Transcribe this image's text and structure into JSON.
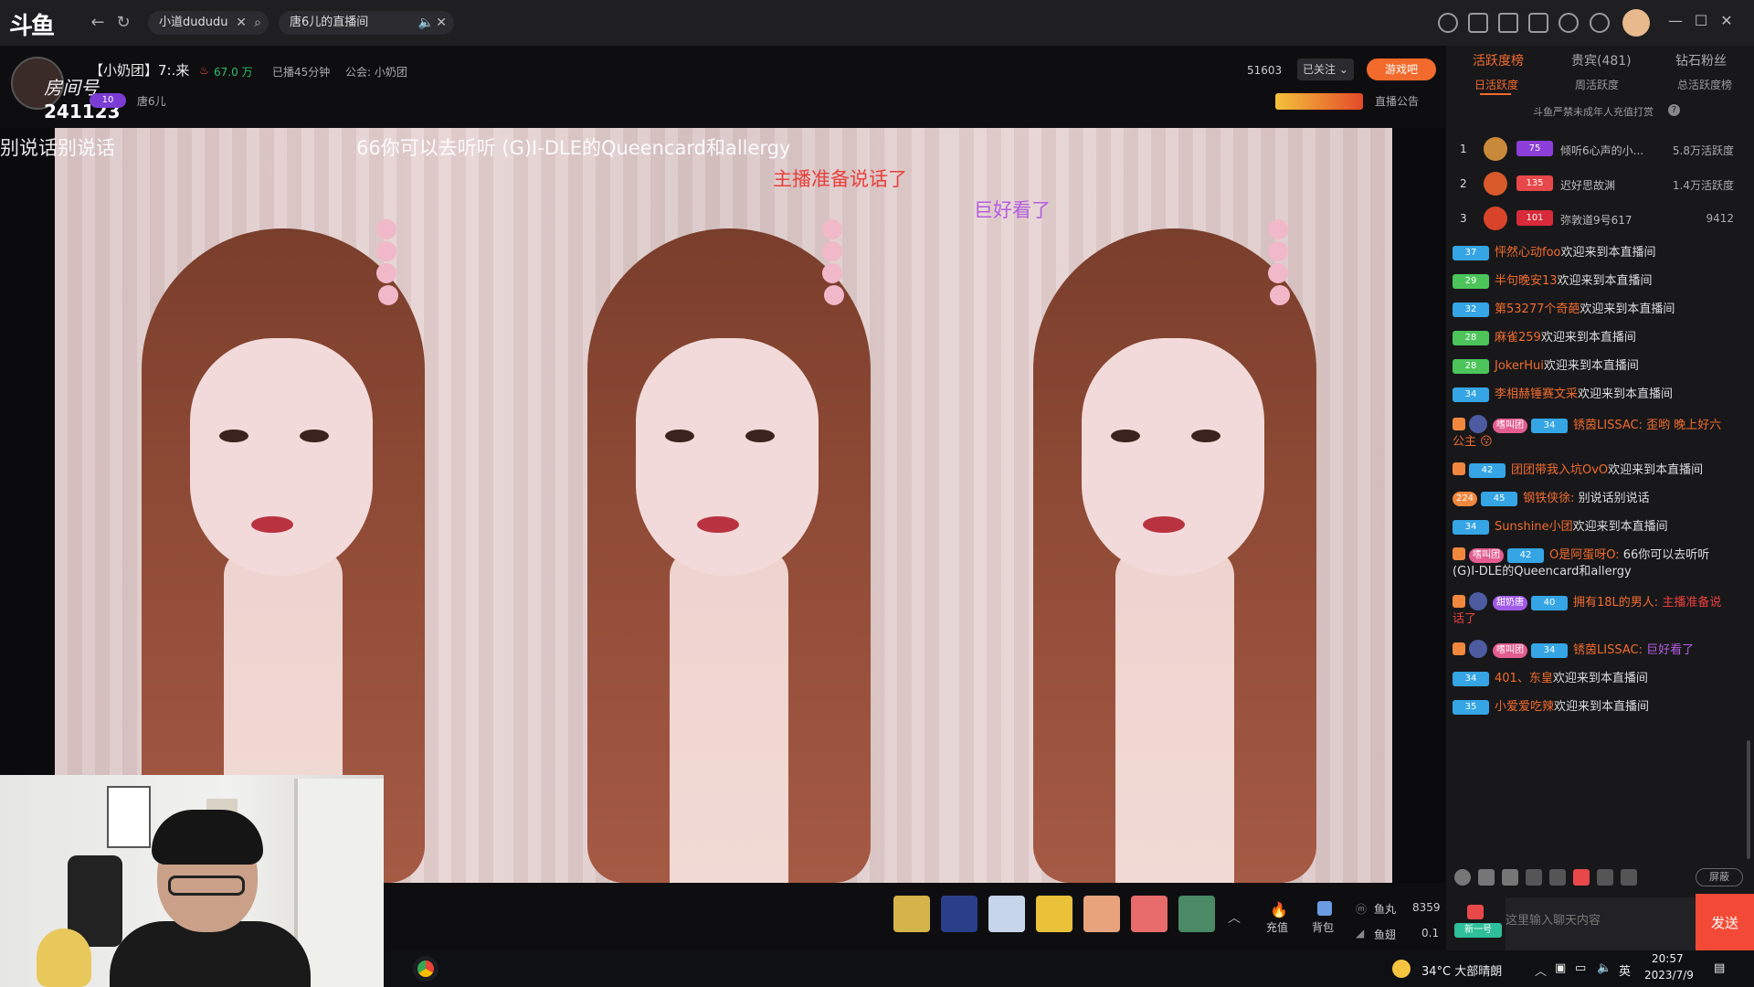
{
  "titlebar": {
    "tabs": [
      {
        "label": "小道dududu"
      },
      {
        "label": "唐6儿的直播间"
      }
    ]
  },
  "room": {
    "title": "【小奶团】7:.来",
    "heat": "67.0 万",
    "duration": "已播45分钟",
    "guild": "公会: 小奶团",
    "room_id": "241123",
    "room_label": "房间号",
    "streamer_name": "唐6儿",
    "follower_count": "51603",
    "follow_status": "已关注",
    "game_btn": "游戏吧",
    "announcement": "直播公告",
    "badge_level": "10"
  },
  "danmu": [
    {
      "text": "别说话别说话",
      "color": "#ffffff"
    },
    {
      "text": "66你可以去听听 (G)I-DLE的Queencard和allergy",
      "color": "#ffffff"
    },
    {
      "text": "主播准备说话了",
      "color": "#e8403c"
    },
    {
      "text": "巨好看了",
      "color": "#b45ee0"
    }
  ],
  "bottom": {
    "recharge": "充值",
    "backpack": "背包",
    "fish_ball_label": "鱼丸",
    "fish_ball_value": "8359",
    "fish_wing_label": "鱼翅",
    "fish_wing_value": "0.1"
  },
  "rank": {
    "tabs": [
      "活跃度榜",
      "贵宾(481)",
      "钻石粉丝"
    ],
    "subtabs": [
      "日活跃度",
      "周活跃度",
      "总活跃度榜"
    ],
    "notice": "斗鱼严禁未成年人充值打赏",
    "rows": [
      {
        "rank": "1",
        "level": "75",
        "name": "倾听6心声的小...",
        "score": "5.8万活跃度"
      },
      {
        "rank": "2",
        "level": "135",
        "name": "迟好思故渊",
        "score": "1.4万活跃度"
      },
      {
        "rank": "3",
        "level": "101",
        "name": "弥敦道9号617",
        "score": "9412"
      }
    ]
  },
  "chat": {
    "messages": [
      {
        "level": "37",
        "user": "怦然心动foo",
        "text": "欢迎来到本直播间"
      },
      {
        "level": "29",
        "user": "半句晚安13",
        "text": "欢迎来到本直播间"
      },
      {
        "level": "32",
        "user": "第53277个奇葩",
        "text": "欢迎来到本直播间"
      },
      {
        "level": "28",
        "user": "麻雀259",
        "text": "欢迎来到本直播间"
      },
      {
        "level": "28",
        "user": "JokerHui",
        "text": "欢迎来到本直播间"
      },
      {
        "level": "34",
        "user": "李相赫锤赛文采",
        "text": "欢迎来到本直播间"
      },
      {
        "level": "34",
        "fan": "嗜叫团",
        "user": "锈茵LISSAC:",
        "text": "歪哟 晚上好六公主 😗"
      },
      {
        "level": "42",
        "user": "团团带我入坑OvO",
        "text": "欢迎来到本直播间"
      },
      {
        "level": "45",
        "fan": "224",
        "user": "钢铁侠徐:",
        "text": "别说话别说话"
      },
      {
        "level": "34",
        "user": "Sunshine小团",
        "text": "欢迎来到本直播间"
      },
      {
        "level": "42",
        "fan": "嗜叫团",
        "user": "O是阿蛋呀O:",
        "text": "66你可以去听听 (G)I-DLE的Queencard和allergy"
      },
      {
        "level": "40",
        "fan": "甜奶唐",
        "user": "拥有18L的男人:",
        "text": "主播准备说话了"
      },
      {
        "level": "34",
        "fan": "嗜叫团",
        "user": "锈茵LISSAC:",
        "text": "巨好看了"
      },
      {
        "level": "34",
        "user": "401、东皇",
        "text": "欢迎来到本直播间"
      },
      {
        "level": "35",
        "user": "小爱爱吃辣",
        "text": "欢迎来到本直播间"
      }
    ],
    "input_placeholder": "这里输入聊天内容",
    "send_label": "发送",
    "shield_label": "屏蔽",
    "identity_label": "新一号"
  },
  "taskbar": {
    "weather": "34°C 大部晴朗",
    "ime": "英",
    "time": "20:57",
    "date": "2023/7/9"
  },
  "colors": {
    "accent": "#f26b2c",
    "send": "#f24a36",
    "level_blue": "#35a5e6",
    "level_green": "#4cc45a"
  }
}
